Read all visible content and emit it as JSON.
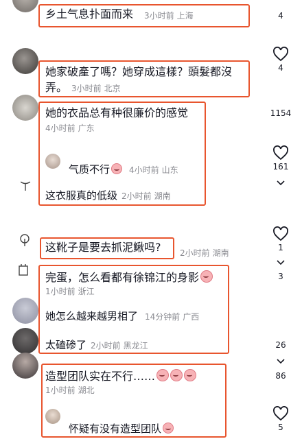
{
  "comments": [
    {
      "text": "乡土气息扑面而来",
      "time": "3小时前",
      "location": "上海",
      "likes": "4"
    },
    {
      "text_line1": "她家破產了嗎？她穿成這樣？頭髮都沒",
      "text_line2": "弄。",
      "time": "3小时前",
      "location": "北京",
      "likes": "4"
    },
    {
      "text": "她的衣品总有种很廉价的感觉",
      "time": "4小时前",
      "location": "广东",
      "likes": "1154",
      "replies": [
        {
          "text": "气质不行",
          "time": "4小时前",
          "location": "山东",
          "likes": "161"
        },
        {
          "text": "这衣服真的低级",
          "time": "2小时前",
          "location": "湖南"
        }
      ]
    },
    {
      "text": "这靴子是要去抓泥鳅吗?",
      "time": "2小时前",
      "location": "湖南",
      "likes": "1"
    },
    {
      "text": "完蛋，怎么看都有徐锦江的身影",
      "time": "1小时前",
      "location": "浙江",
      "likes": "3",
      "replies": [
        {
          "text": "她怎么越来越男相了",
          "time": "14分钟前",
          "location": "广西"
        },
        {
          "text": "太磕碜了",
          "time": "2小时前",
          "location": "黑龙江",
          "likes": "26"
        }
      ]
    },
    {
      "text": "造型团队实在不行……",
      "time": "1小时前",
      "location": "湖北",
      "likes": "86",
      "replies": [
        {
          "text": "怀疑有没有造型团队",
          "likes": "5"
        }
      ]
    }
  ],
  "icons": {
    "like": "heart-outline-icon",
    "expand": "chevron-down-icon",
    "emoji": "crying-face-emoji-icon"
  },
  "colors": {
    "highlight_box": "#e8552e",
    "meta_text": "#8a8b91"
  }
}
